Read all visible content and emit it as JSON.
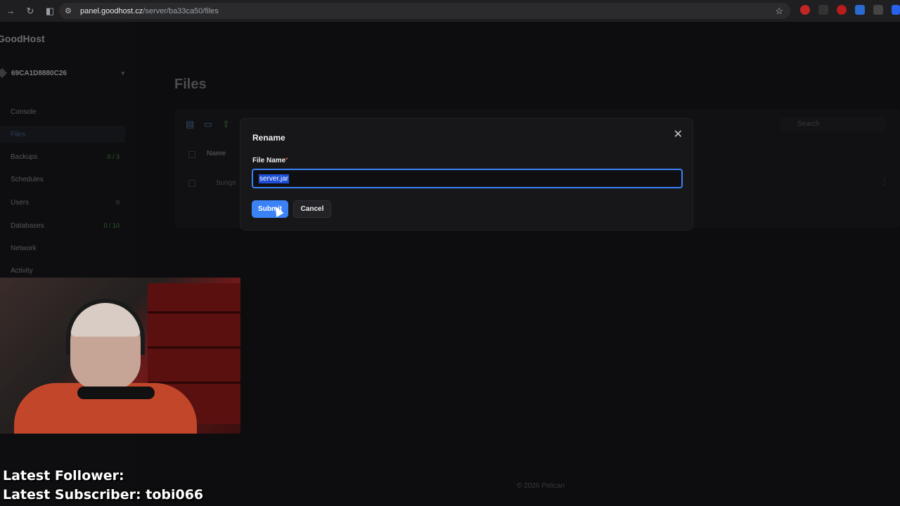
{
  "browser": {
    "url_host": "panel.goodhost.cz",
    "url_path": "/server/ba33ca50/files"
  },
  "sidebar": {
    "brand": "GoodHost",
    "server_name": "69CA1D8880C26",
    "items": [
      {
        "label": "Console",
        "badge": ""
      },
      {
        "label": "Files",
        "badge": ""
      },
      {
        "label": "Backups",
        "badge": "0 / 3"
      },
      {
        "label": "Schedules",
        "badge": ""
      },
      {
        "label": "Users",
        "badge": "0"
      },
      {
        "label": "Databases",
        "badge": "0 / 10"
      },
      {
        "label": "Network",
        "badge": ""
      },
      {
        "label": "Activity",
        "badge": ""
      }
    ]
  },
  "main": {
    "title": "Files",
    "search_placeholder": "Search",
    "column_name": "Name",
    "row_name": "bunge"
  },
  "modal": {
    "title": "Rename",
    "field_label": "File Name",
    "required_mark": "*",
    "field_value": "server.jar",
    "submit_label": "Submit",
    "cancel_label": "Cancel"
  },
  "footer": {
    "copyright": "© 2026 Pelican"
  },
  "stream_overlay": {
    "latest_follower": "Latest Follower:",
    "latest_subscriber": "Latest Subscriber: tobi066"
  },
  "colors": {
    "accent": "#3b82f6",
    "background": "#0d0d0f",
    "modal": "#17171a"
  }
}
